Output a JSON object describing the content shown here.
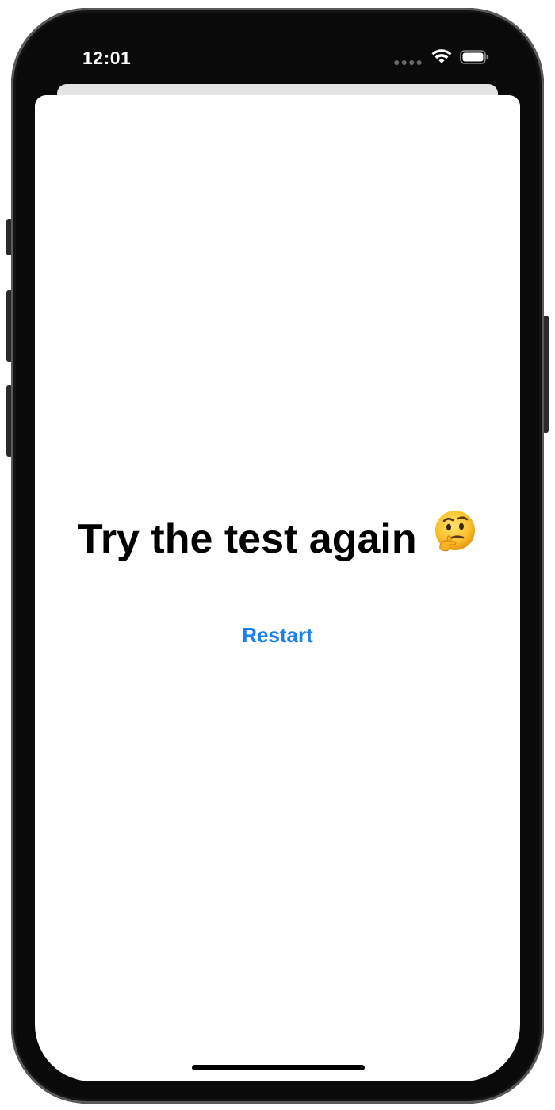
{
  "status_bar": {
    "time": "12:01",
    "signal_icon": "cellular-dots-icon",
    "wifi_icon": "wifi-icon",
    "battery_icon": "battery-icon"
  },
  "content": {
    "title": "Try the test again",
    "title_emoji": "thinking-face-emoji",
    "restart_label": "Restart"
  },
  "colors": {
    "accent": "#1a7ff0",
    "text": "#000000",
    "background": "#ffffff",
    "bezel": "#0a0a0a"
  }
}
